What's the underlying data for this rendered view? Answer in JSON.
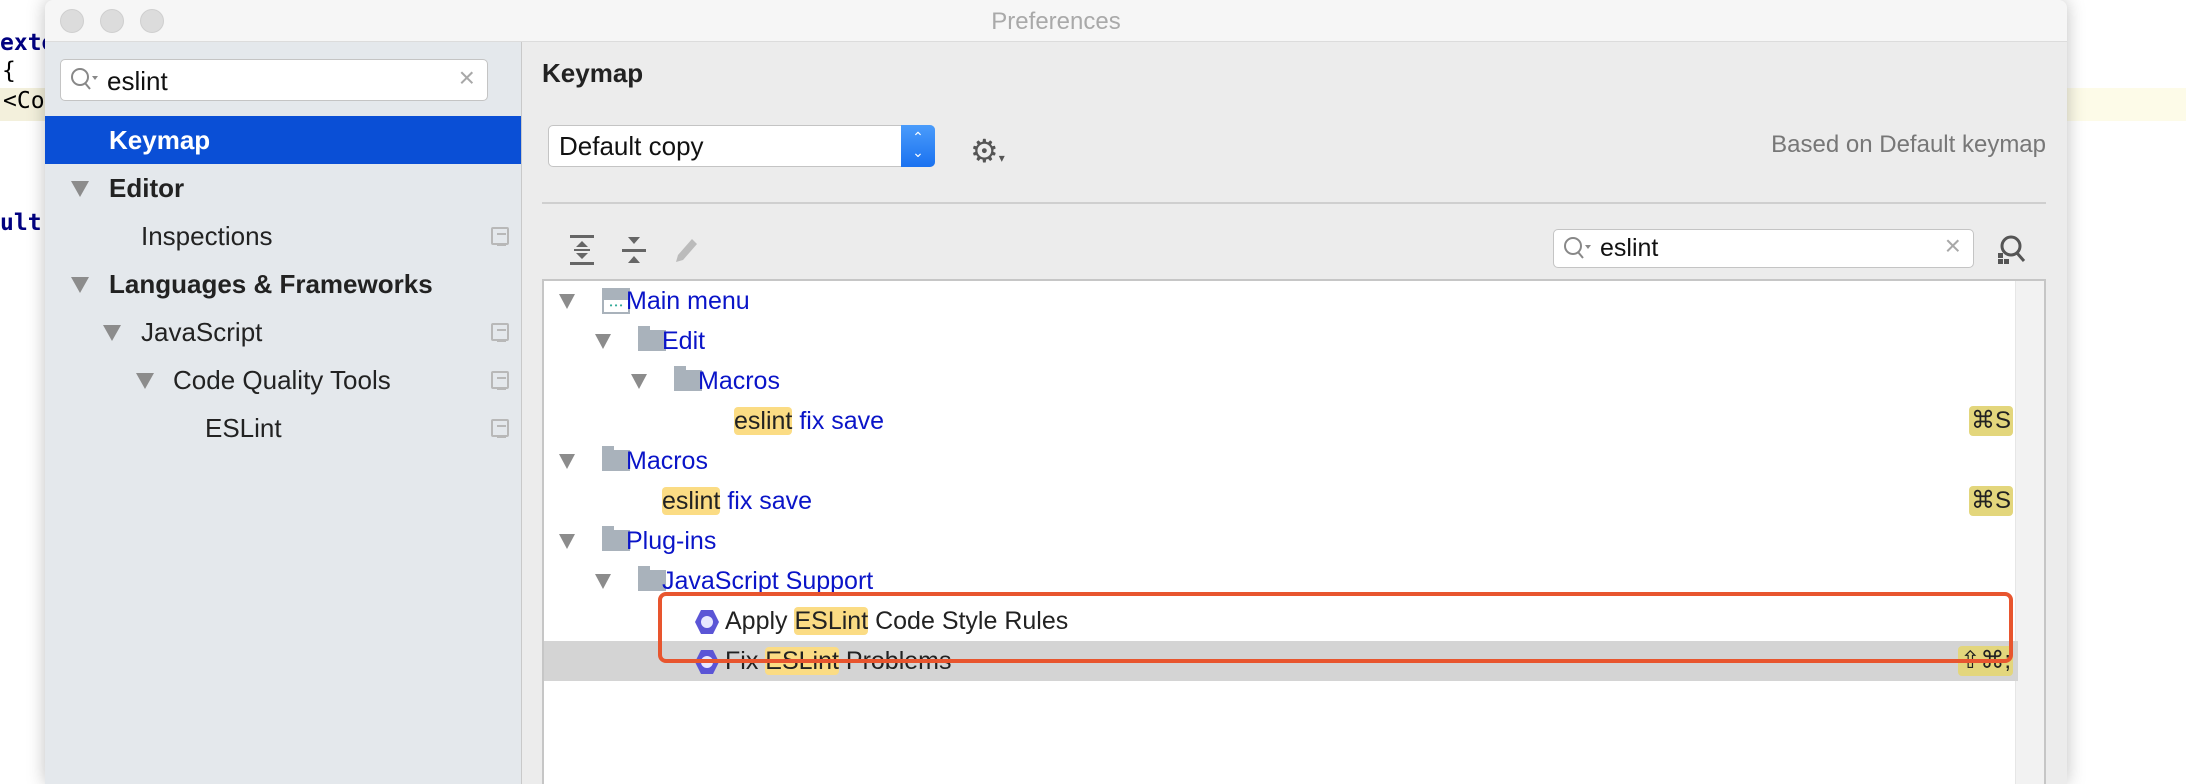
{
  "window": {
    "title": "Preferences"
  },
  "background_code": {
    "line1": "exte",
    "line2": "{",
    "line3": "<Co",
    "line4": "ult"
  },
  "sidebar": {
    "search": {
      "value": "eslint"
    },
    "items": [
      {
        "label": "Keymap",
        "selected": true
      },
      {
        "label": "Editor",
        "expanded": true
      },
      {
        "label": "Inspections"
      },
      {
        "label": "Languages & Frameworks",
        "expanded": true
      },
      {
        "label": "JavaScript",
        "expanded": true
      },
      {
        "label": "Code Quality Tools",
        "expanded": true
      },
      {
        "label": "ESLint"
      }
    ]
  },
  "main": {
    "title": "Keymap",
    "keymap_select": {
      "value": "Default copy"
    },
    "based_on": "Based on Default keymap",
    "toolbar": {
      "expand_all": "expand-all-icon",
      "collapse_all": "collapse-all-icon",
      "edit": "edit-icon"
    },
    "search": {
      "value": "eslint"
    },
    "tree": [
      {
        "level": 0,
        "icon": "main-menu-icon",
        "expanded": true,
        "parts": [
          "Main menu",
          "",
          ""
        ],
        "color": "#0a14c8"
      },
      {
        "level": 1,
        "icon": "folder-icon",
        "expanded": true,
        "parts": [
          "Edit",
          "",
          ""
        ],
        "color": "#0a14c8"
      },
      {
        "level": 2,
        "icon": "folder-icon",
        "expanded": true,
        "parts": [
          "Macros",
          "",
          ""
        ],
        "color": "#0a14c8"
      },
      {
        "level": 3,
        "icon": "",
        "parts": [
          "",
          "eslint",
          " fix save"
        ],
        "shortcut": "⌘S",
        "color": "#0a14c8"
      },
      {
        "level": 0,
        "icon": "folder-icon",
        "expanded": true,
        "parts": [
          "Macros",
          "",
          ""
        ],
        "color": "#0a14c8"
      },
      {
        "level": 1,
        "icon": "",
        "parts": [
          "",
          "eslint",
          " fix save"
        ],
        "shortcut": "⌘S",
        "color": "#0a14c8"
      },
      {
        "level": 0,
        "icon": "folder-icon",
        "expanded": true,
        "parts": [
          "Plug-ins",
          "",
          ""
        ],
        "color": "#0a14c8"
      },
      {
        "level": 1,
        "icon": "folder-icon",
        "expanded": true,
        "parts": [
          "JavaScript Support",
          "",
          ""
        ],
        "color": "#0a14c8"
      },
      {
        "level": 2,
        "icon": "eslint-plugin-icon",
        "parts": [
          "Apply ",
          "ESLint",
          " Code Style Rules"
        ],
        "color": "#222222"
      },
      {
        "level": 2,
        "icon": "eslint-plugin-icon",
        "parts": [
          "Fix ",
          "ESLint",
          " Problems"
        ],
        "shortcut": "⇧⌘;",
        "color": "#222222",
        "selected": true
      }
    ]
  },
  "colors": {
    "selection": "#0a4fd6",
    "highlight": "#fbdc84",
    "annotation": "#e8552e",
    "link": "#0a14c8"
  }
}
